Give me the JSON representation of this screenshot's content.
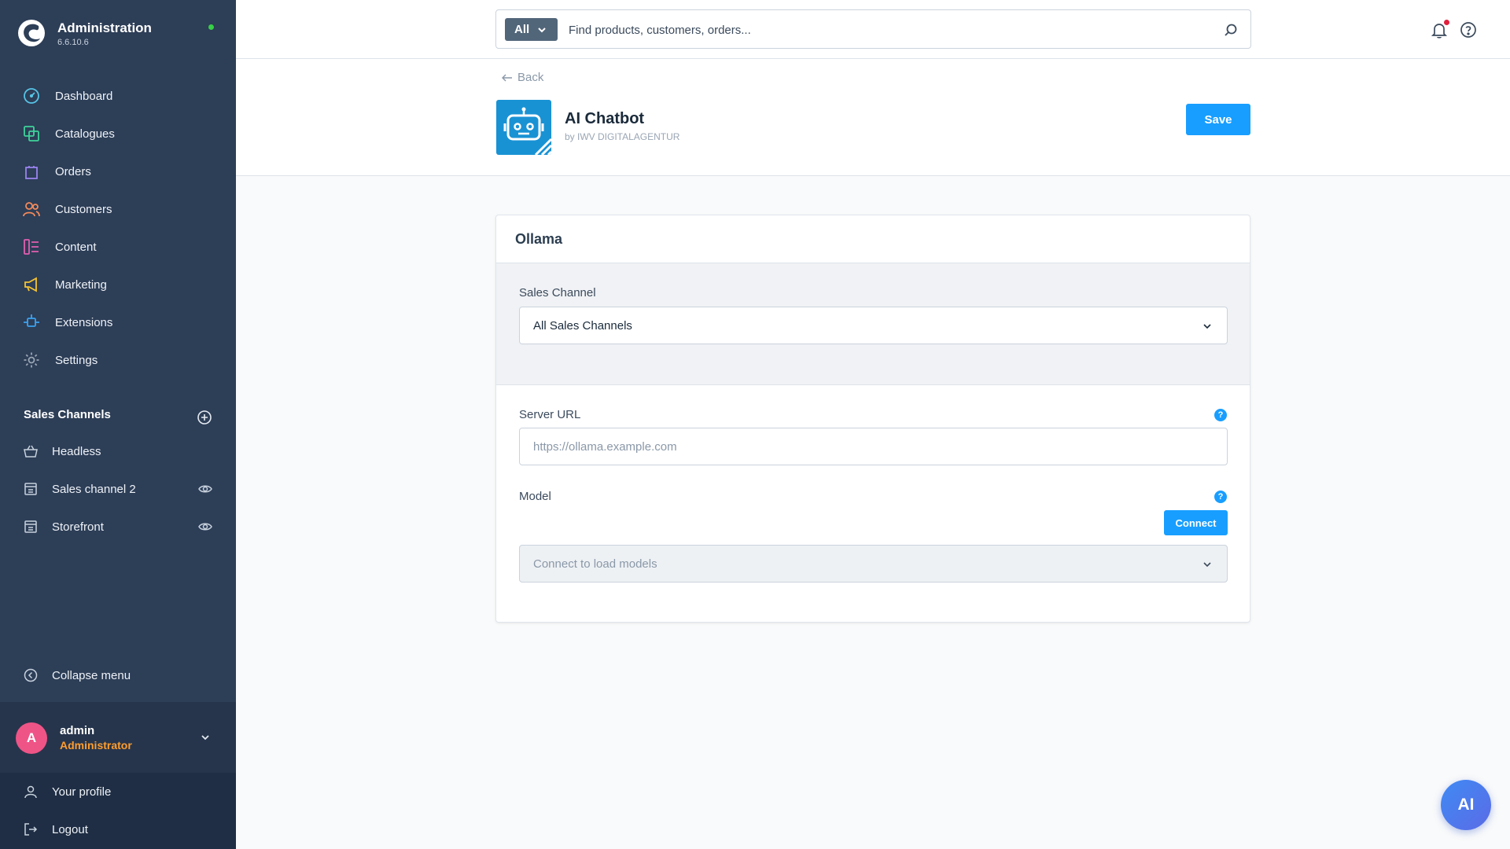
{
  "brand": {
    "title": "Administration",
    "version": "6.6.10.6"
  },
  "nav": [
    {
      "label": "Dashboard",
      "icon": "dashboard-icon",
      "color": "#57c4e5"
    },
    {
      "label": "Catalogues",
      "icon": "catalogues-icon",
      "color": "#3fd39a"
    },
    {
      "label": "Orders",
      "icon": "orders-icon",
      "color": "#9a84f0"
    },
    {
      "label": "Customers",
      "icon": "customers-icon",
      "color": "#f48a5a"
    },
    {
      "label": "Content",
      "icon": "content-icon",
      "color": "#e05fb0"
    },
    {
      "label": "Marketing",
      "icon": "marketing-icon",
      "color": "#f5c431"
    },
    {
      "label": "Extensions",
      "icon": "extensions-icon",
      "color": "#3ba3f0"
    },
    {
      "label": "Settings",
      "icon": "settings-icon",
      "color": "#9aa6b4"
    }
  ],
  "sales_channels": {
    "title": "Sales Channels",
    "items": [
      {
        "label": "Headless"
      },
      {
        "label": "Sales channel 2"
      },
      {
        "label": "Storefront"
      }
    ]
  },
  "collapse_label": "Collapse menu",
  "user": {
    "initial": "A",
    "name": "admin",
    "role": "Administrator"
  },
  "account": {
    "profile": "Your profile",
    "logout": "Logout"
  },
  "search": {
    "type": "All",
    "placeholder": "Find products, customers, orders..."
  },
  "header": {
    "back": "Back",
    "plugin_name": "AI Chatbot",
    "plugin_by": "by IWV DIGITALAGENTUR",
    "save": "Save"
  },
  "card": {
    "title": "Ollama",
    "sales_channel_label": "Sales Channel",
    "sales_channel_value": "All Sales Channels",
    "server_url_label": "Server URL",
    "server_url_placeholder": "https://ollama.example.com",
    "model_label": "Model",
    "connect": "Connect",
    "model_placeholder": "Connect to load models",
    "help": "?"
  },
  "fab": "AI",
  "colors": {
    "sidebar": "#2d3e57",
    "accent": "#189eff",
    "role": "#ff9d2e",
    "avatar": "#ef5487"
  }
}
